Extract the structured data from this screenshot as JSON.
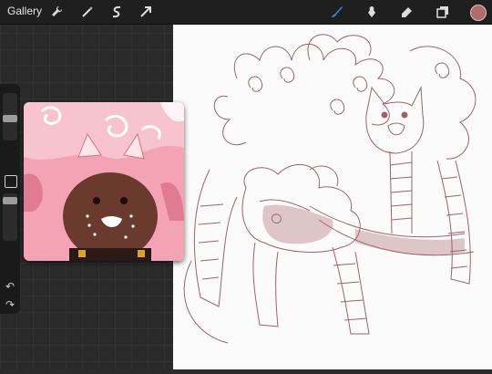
{
  "topbar": {
    "gallery_label": "Gallery",
    "tools_left": [
      "wrench-icon",
      "magic-wand-icon",
      "s-curve-icon",
      "arrow-icon"
    ],
    "tools_right": [
      "brush-icon",
      "smudge-icon",
      "eraser-icon",
      "layers-icon"
    ],
    "active_tool": "brush-icon",
    "current_color": "#b56a6a"
  },
  "sidebar": {
    "brush_size_slider": "brush-size",
    "opacity_slider": "opacity",
    "modifier_label": "",
    "undo_symbol": "↶",
    "redo_symbol": "↷"
  },
  "reference": {
    "window_name": "reference-image"
  },
  "colors": {
    "accent": "#2a8cff",
    "sketch_line": "#7a3b43",
    "ref_pink": "#f4a3b4",
    "ref_brown": "#6b3a2e"
  }
}
